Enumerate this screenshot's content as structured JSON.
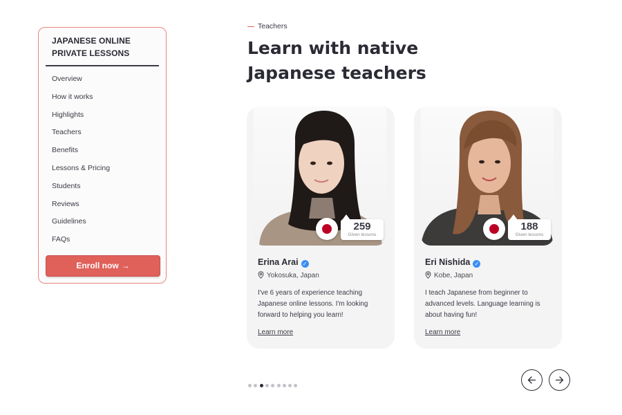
{
  "sidebar": {
    "title": "JAPANESE ONLINE PRIVATE LESSONS",
    "items": [
      {
        "label": "Overview"
      },
      {
        "label": "How it works"
      },
      {
        "label": "Highlights"
      },
      {
        "label": "Teachers"
      },
      {
        "label": "Benefits"
      },
      {
        "label": "Lessons & Pricing"
      },
      {
        "label": "Students"
      },
      {
        "label": "Reviews"
      },
      {
        "label": "Guidelines"
      },
      {
        "label": "FAQs"
      }
    ],
    "enroll_label": "Enroll now",
    "enroll_icon": "arrow-right-icon"
  },
  "section": {
    "eyebrow": "Teachers",
    "heading": "Learn with native Japanese teachers"
  },
  "teachers": [
    {
      "name": "Erina Arai",
      "location": "Yokosuka, Japan",
      "lessons_count": "259",
      "lessons_label": "Given lessons",
      "bio": "I've 6 years of experience teaching Japanese online lessons. I'm looking forward to helping you learn!",
      "link": "Learn more",
      "flag": "japan-flag-icon"
    },
    {
      "name": "Eri Nishida",
      "location": "Kobe, Japan",
      "lessons_count": "188",
      "lessons_label": "Given lessons",
      "bio": "I teach Japanese from beginner to advanced levels. Language learning is about having fun!",
      "link": "Learn more",
      "flag": "japan-flag-icon"
    }
  ],
  "carousel": {
    "dot_count": 9,
    "active_index": 2
  },
  "colors": {
    "accent": "#e0605a",
    "text": "#2b2b35",
    "card_bg": "#f4f4f5",
    "verified": "#3b8ff3",
    "flag_red": "#bc0024"
  }
}
